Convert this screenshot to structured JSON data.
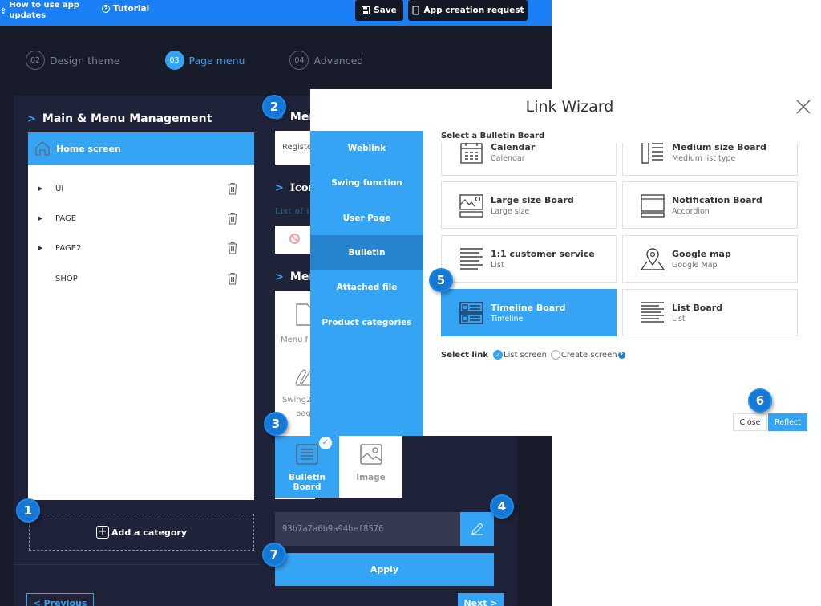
{
  "topbar": {
    "help_label_line1": "How to use app",
    "help_label_line2": "updates",
    "tutorial_label": "Tutorial",
    "save_label": "Save",
    "request_label": "App creation request"
  },
  "steps": [
    {
      "num": "02",
      "label": "Design theme",
      "active": false
    },
    {
      "num": "03",
      "label": "Page menu",
      "active": true
    },
    {
      "num": "04",
      "label": "Advanced",
      "active": false
    }
  ],
  "main_menu": {
    "title": "Main & Menu Management",
    "home_label": "Home screen",
    "items": [
      {
        "label": "UI",
        "expandable": true
      },
      {
        "label": "PAGE",
        "expandable": true
      },
      {
        "label": "PAGE2",
        "expandable": true
      },
      {
        "label": "SHOP",
        "expandable": false
      }
    ],
    "add_category_label": "Add a category"
  },
  "right_panel": {
    "menu_title_partial": "Men",
    "register_partial": "Registe",
    "icon_title_partial": "Icon",
    "icon_list_partial": "List of ic",
    "menu_section_partial": "Men",
    "menu_file_partial": "Menu f",
    "swing_partial": "Swing2",
    "page_partial": "pag",
    "bulletin_board_label": "Bulletin Board",
    "image_label": "Image",
    "link_value": "93b7a7a6b9a94bef8576",
    "apply_label": "Apply"
  },
  "nav": {
    "previous_label": "< Previous",
    "next_label": "Next >"
  },
  "wizard": {
    "title": "Link Wizard",
    "sidebar": [
      {
        "label": "Weblink",
        "active": false
      },
      {
        "label": "Swing function",
        "active": false
      },
      {
        "label": "User Page",
        "active": false
      },
      {
        "label": "Bulletin",
        "active": true
      },
      {
        "label": "Attached file",
        "active": false
      },
      {
        "label": "Product categories",
        "active": false
      }
    ],
    "select_label": "Select a Bulletin Board",
    "boards": [
      {
        "title": "Calendar",
        "subtitle": "Calendar",
        "icon": "calendar-icon",
        "selected": false
      },
      {
        "title": "Medium size Board",
        "subtitle": "Medium list type",
        "icon": "medium-list-icon",
        "selected": false
      },
      {
        "title": "Large size Board",
        "subtitle": "Large size",
        "icon": "large-image-icon",
        "selected": false
      },
      {
        "title": "Notification Board",
        "subtitle": "Accordion",
        "icon": "accordion-icon",
        "selected": false
      },
      {
        "title": "1:1 customer service",
        "subtitle": "List",
        "icon": "list-icon",
        "selected": false
      },
      {
        "title": "Google map",
        "subtitle": "Google Map",
        "icon": "map-pin-icon",
        "selected": false
      },
      {
        "title": "Timeline Board",
        "subtitle": "Timeline",
        "icon": "timeline-icon",
        "selected": true
      },
      {
        "title": "List Board",
        "subtitle": "List",
        "icon": "list-icon",
        "selected": false
      }
    ],
    "select_link_label": "Select link",
    "link_options": [
      {
        "label": "List screen",
        "selected": true
      },
      {
        "label": "Create screen",
        "selected": false
      }
    ],
    "close_label": "Close",
    "reflect_label": "Reflect"
  },
  "badges": [
    "1",
    "2",
    "3",
    "4",
    "5",
    "6",
    "7"
  ],
  "colors": {
    "topbar": "#1a7ef5",
    "accent": "#35a4f4",
    "accent_dark": "#2683cf",
    "background": "#181b2a",
    "panel": "#1f2339",
    "badge": "#1478d4"
  }
}
